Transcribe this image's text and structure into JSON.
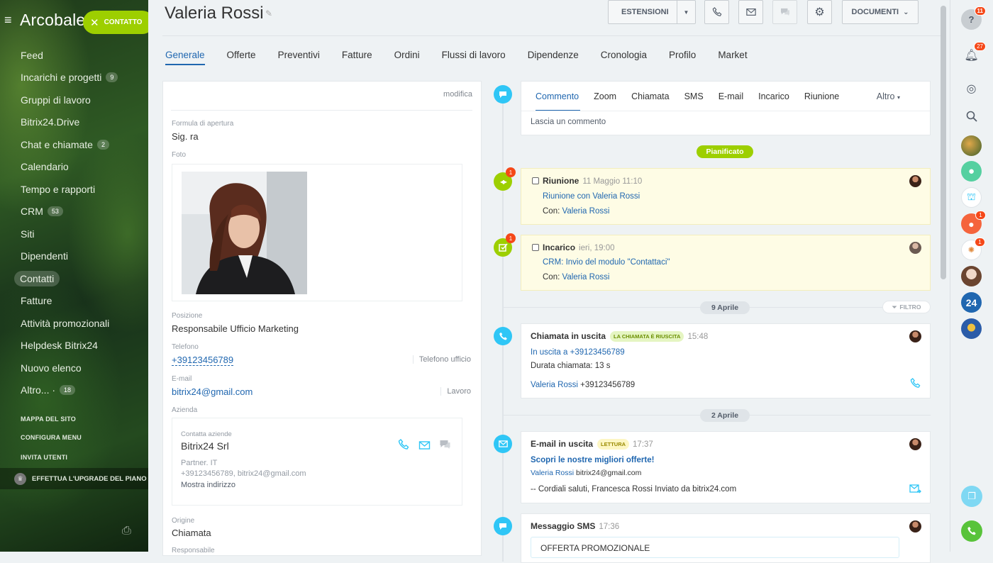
{
  "sidebar": {
    "logo": "Arcobale",
    "contact_pill": "CONTATTO",
    "items": [
      {
        "label": "Feed",
        "count": ""
      },
      {
        "label": "Incarichi e progetti",
        "count": "9"
      },
      {
        "label": "Gruppi di lavoro",
        "count": ""
      },
      {
        "label": "Bitrix24.Drive",
        "count": ""
      },
      {
        "label": "Chat e chiamate",
        "count": "2"
      },
      {
        "label": "Calendario",
        "count": ""
      },
      {
        "label": "Tempo e rapporti",
        "count": ""
      },
      {
        "label": "CRM",
        "count": "53"
      },
      {
        "label": "Siti",
        "count": ""
      },
      {
        "label": "Dipendenti",
        "count": ""
      },
      {
        "label": "Contatti",
        "count": ""
      },
      {
        "label": "Fatture",
        "count": ""
      },
      {
        "label": "Attività promozionali",
        "count": ""
      },
      {
        "label": "Helpdesk Bitrix24",
        "count": ""
      },
      {
        "label": "Nuovo elenco",
        "count": ""
      },
      {
        "label": "Altro... ·",
        "count": "18"
      }
    ],
    "sitemap": "MAPPA DEL SITO",
    "configure": "CONFIGURA MENU",
    "invite": "INVITA UTENTI",
    "upgrade": "EFFETTUA L'UPGRADE DEL PIANO"
  },
  "header": {
    "title": "Valeria Rossi",
    "extensions": "ESTENSIONI",
    "documents": "DOCUMENTI"
  },
  "tabs": [
    "Generale",
    "Offerte",
    "Preventivi",
    "Fatture",
    "Ordini",
    "Flussi di lavoro",
    "Dipendenze",
    "Cronologia",
    "Profilo",
    "Market"
  ],
  "details": {
    "edit": "modifica",
    "salutation_label": "Formula di apertura",
    "salutation": "Sig. ra",
    "photo_label": "Foto",
    "position_label": "Posizione",
    "position": "Responsabile Ufficio Marketing",
    "phone_label": "Telefono",
    "phone": "+39123456789",
    "phone_type": "Telefono ufficio",
    "email_label": "E-mail",
    "email": "bitrix24@gmail.com",
    "email_type": "Lavoro",
    "company_label": "Azienda",
    "company_sub": "Contatta aziende",
    "company_name": "Bitrix24 Srl",
    "company_partner": "Partner. IT",
    "company_contacts": "+39123456789, bitrix24@gmail.com",
    "company_address": "Mostra indirizzo",
    "source_label": "Origine",
    "source": "Chiamata",
    "responsible_label": "Responsabile"
  },
  "editor": {
    "tabs": [
      "Commento",
      "Zoom",
      "Chiamata",
      "SMS",
      "E-mail",
      "Incarico",
      "Riunione"
    ],
    "more": "Altro",
    "placeholder": "Lascia un commento"
  },
  "timeline": {
    "planned": "Pianificato",
    "meeting": {
      "badge": "1",
      "title": "Riunione",
      "time": "11 Maggio 11:10",
      "link": "Riunione con Valeria Rossi",
      "with_label": "Con:",
      "with": "Valeria Rossi"
    },
    "task": {
      "badge": "1",
      "title": "Incarico",
      "time": "ieri, 19:00",
      "link": "CRM: Invio del modulo \"Contattaci\"",
      "with_label": "Con:",
      "with": "Valeria Rossi"
    },
    "date1": "9 Aprile",
    "filter": "FILTRO",
    "call": {
      "title": "Chiamata in uscita",
      "tag": "LA CHIAMATA È RIUSCITA",
      "time": "15:48",
      "link": "In uscita a +39123456789",
      "duration": "Durata chiamata: 13 s",
      "contact": "Valeria Rossi",
      "contact_phone": "+39123456789"
    },
    "date2": "2 Aprile",
    "email": {
      "title": "E-mail in uscita",
      "tag": "LETTURA",
      "time": "17:37",
      "subject": "Scopri le nostre migliori offerte!",
      "contact": "Valeria Rossi",
      "contact_email": "bitrix24@gmail.com",
      "body": "-- Cordiali saluti, Francesca Rossi Inviato da bitrix24.com"
    },
    "sms": {
      "title": "Messaggio SMS",
      "time": "17:36",
      "text": "OFFERTA PROMOZIONALE"
    }
  },
  "rightbar": {
    "help_badge": "11",
    "notif_badge": "27",
    "b1": "1",
    "b2": "1",
    "b24": "24"
  },
  "colors": {
    "accent": "#2067b0",
    "green": "#9dcf00",
    "timeline_blue": "#2fc6f6",
    "badge": "#f54819"
  }
}
